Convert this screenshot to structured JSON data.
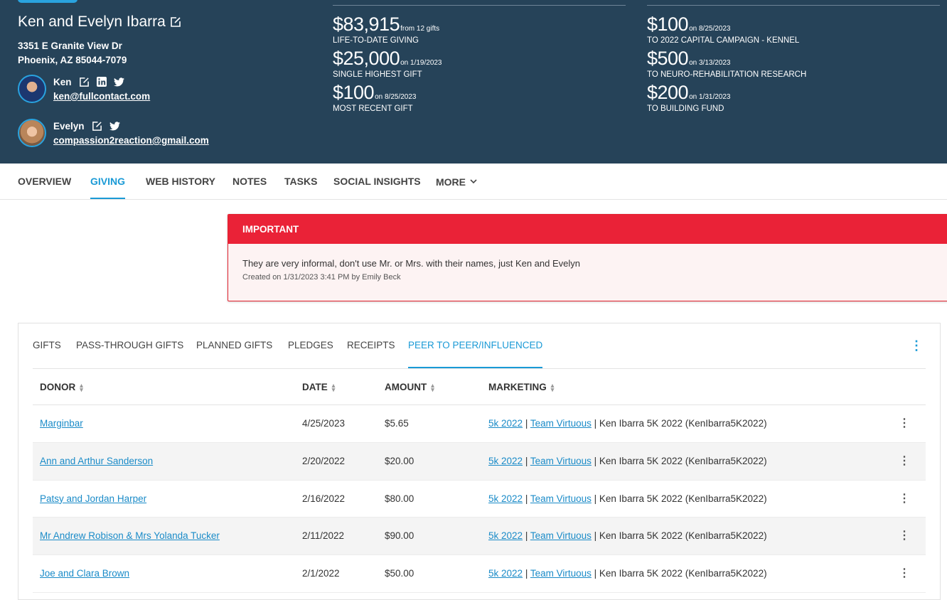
{
  "header": {
    "donor_name": "Ken and Evelyn Ibarra",
    "address_line1": "3351 E Granite View Dr",
    "address_line2": "Phoenix, AZ 85044-7079",
    "people": [
      {
        "name": "Ken",
        "email": "ken@fullcontact.com",
        "icons": [
          "edit-icon",
          "linkedin-icon",
          "twitter-icon"
        ]
      },
      {
        "name": "Evelyn",
        "email": "compassion2reaction@gmail.com",
        "icons": [
          "edit-icon",
          "twitter-icon"
        ]
      }
    ],
    "giving_summary": {
      "stats": [
        {
          "amount": "$83,915",
          "note": "from 12 gifts",
          "label": "LIFE-TO-DATE GIVING"
        },
        {
          "amount": "$25,000",
          "note": "on 1/19/2023",
          "label": "SINGLE HIGHEST GIFT"
        },
        {
          "amount": "$100",
          "note": "on 8/25/2023",
          "label": "MOST RECENT GIFT"
        }
      ]
    },
    "recent_gifts": {
      "stats": [
        {
          "amount": "$100",
          "note": "on 8/25/2023",
          "label": "TO 2022 CAPITAL CAMPAIGN - KENNEL"
        },
        {
          "amount": "$500",
          "note": "on 3/13/2023",
          "label": "TO NEURO-REHABILITATION RESEARCH"
        },
        {
          "amount": "$200",
          "note": "on 1/31/2023",
          "label": "TO BUILDING FUND"
        }
      ]
    }
  },
  "nav": {
    "tabs": [
      "OVERVIEW",
      "GIVING",
      "WEB HISTORY",
      "NOTES",
      "TASKS",
      "SOCIAL INSIGHTS",
      "MORE"
    ],
    "active": "GIVING"
  },
  "alert": {
    "title": "IMPORTANT",
    "text": "They are very informal, don't use Mr. or Mrs. with their names, just Ken and Evelyn",
    "meta": "Created on 1/31/2023 3:41 PM by Emily Beck"
  },
  "gifts": {
    "subtabs": [
      "GIFTS",
      "PASS-THROUGH GIFTS",
      "PLANNED GIFTS",
      "PLEDGES",
      "RECEIPTS",
      "PEER TO PEER/INFLUENCED"
    ],
    "active": "PEER TO PEER/INFLUENCED",
    "columns": [
      "DONOR",
      "DATE",
      "AMOUNT",
      "MARKETING"
    ],
    "rows": [
      {
        "donor": "Marginbar",
        "date": "4/25/2023",
        "amount": "$5.65",
        "m1": "5k 2022",
        "sep1": "|",
        "m2": "Team Virtuous",
        "m3": "| Ken Ibarra 5K 2022 (KenIbarra5K2022)"
      },
      {
        "donor": "Ann and Arthur Sanderson",
        "date": "2/20/2022",
        "amount": "$20.00",
        "m1": "5k 2022",
        "sep1": "|",
        "m2": "Team Virtuous",
        "m3": "| Ken Ibarra 5K 2022 (KenIbarra5K2022)"
      },
      {
        "donor": "Patsy and Jordan Harper",
        "date": "2/16/2022",
        "amount": "$80.00",
        "m1": "5k 2022",
        "sep1": "|",
        "m2": "Team Virtuous",
        "m3": "| Ken Ibarra 5K 2022 (KenIbarra5K2022)"
      },
      {
        "donor": "Mr Andrew Robison & Mrs Yolanda Tucker",
        "date": "2/11/2022",
        "amount": "$90.00",
        "m1": "5k 2022",
        "sep1": "|",
        "m2": "Team Virtuous",
        "m3": "| Ken Ibarra 5K 2022 (KenIbarra5K2022)"
      },
      {
        "donor": "Joe and Clara Brown",
        "date": "2/1/2022",
        "amount": "$50.00",
        "m1": "5k 2022",
        "sep1": "|",
        "m2": "Team Virtuous",
        "m3": "| Ken Ibarra 5K 2022 (KenIbarra5K2022)"
      }
    ]
  },
  "colors": {
    "header_bg": "#264359",
    "accent": "#1a9ad6",
    "alert_red": "#ea2237"
  }
}
